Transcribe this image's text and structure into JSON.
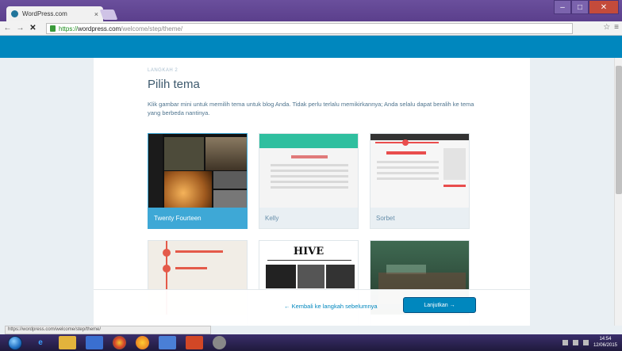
{
  "browser": {
    "tab_title": "WordPress.com",
    "tab_close": "×",
    "url_scheme": "https://",
    "url_host": "wordpress.com",
    "url_path": "/welcome/step/theme/",
    "nav_back": "←",
    "nav_forward": "→",
    "nav_reload": "✕",
    "toolbar_icons": [
      "☆",
      "≡"
    ],
    "window_controls": [
      "–",
      "□",
      "✕"
    ]
  },
  "page": {
    "step_label": "LANGKAH 2",
    "heading": "Pilih tema",
    "intro": "Klik gambar mini untuk memilih tema untuk blog Anda. Tidak perlu terlalu memikirkannya; Anda selalu dapat beralih ke tema yang berbeda nantinya.",
    "themes": [
      {
        "name": "Twenty Fourteen",
        "selected": true
      },
      {
        "name": "Kelly",
        "selected": false
      },
      {
        "name": "Sorbet",
        "selected": false
      },
      {
        "name": "",
        "selected": false
      },
      {
        "name": "",
        "selected": false,
        "logo_text": "HIVE"
      },
      {
        "name": "",
        "selected": false
      }
    ]
  },
  "footer": {
    "back_link": "← Kembali ke langkah sebelumnya",
    "continue_button": "Lanjutkan →"
  },
  "statusbar": {
    "text": "https://wordpress.com/welcome/step/theme/"
  },
  "taskbar": {
    "clock_time": "14:54",
    "clock_date": "12/06/2015"
  },
  "colors": {
    "masterbar": "#0087be",
    "selected_theme": "#3ea8d6",
    "page_bg": "#e9eff3",
    "heading": "#3d596d"
  }
}
